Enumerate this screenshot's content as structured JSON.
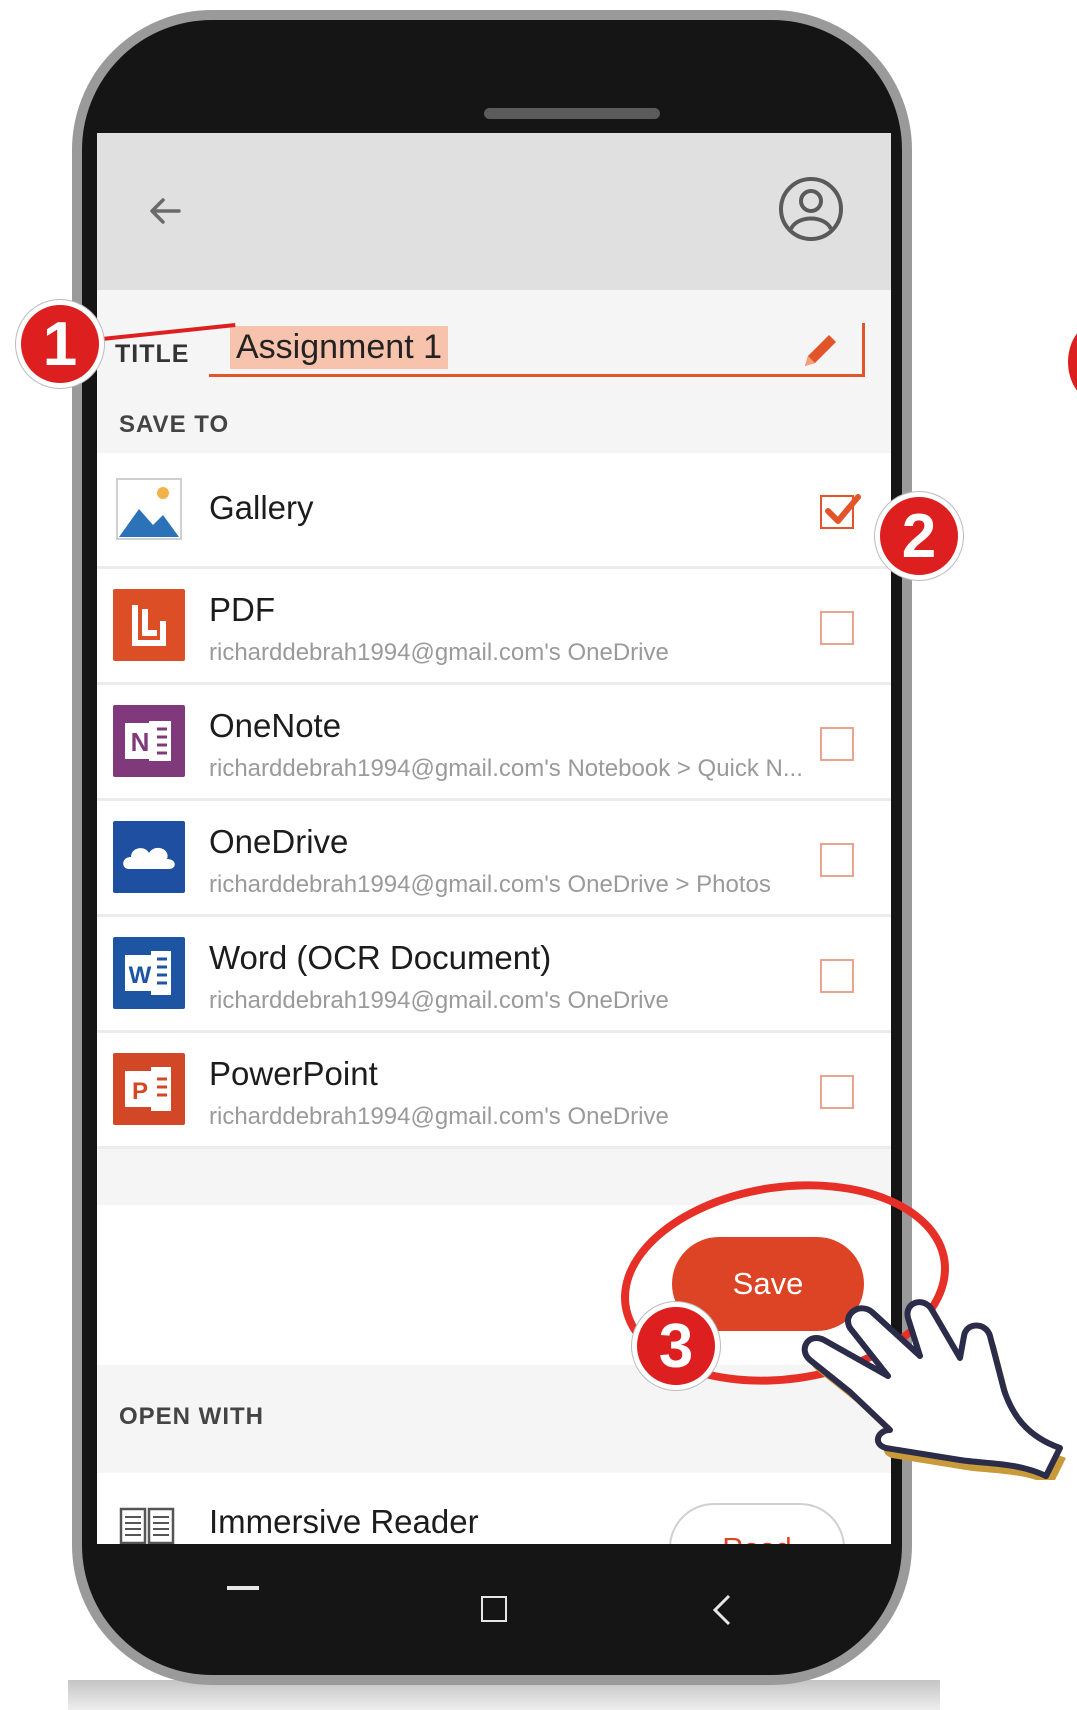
{
  "header": {
    "back_icon": "arrow-left-icon",
    "account_icon": "account-circle-icon"
  },
  "title": {
    "label": "TITLE",
    "value": "Assignment 1",
    "edit_icon": "pencil-icon"
  },
  "save_to": {
    "label": "SAVE TO",
    "items": [
      {
        "name": "Gallery",
        "subtitle": "",
        "checked": true,
        "icon": "gallery-icon"
      },
      {
        "name": "PDF",
        "subtitle": "richarddebrah1994@gmail.com's OneDrive",
        "checked": false,
        "icon": "pdf-icon"
      },
      {
        "name": "OneNote",
        "subtitle": "richarddebrah1994@gmail.com's Notebook > Quick N...",
        "checked": false,
        "icon": "onenote-icon"
      },
      {
        "name": "OneDrive",
        "subtitle": "richarddebrah1994@gmail.com's OneDrive > Photos",
        "checked": false,
        "icon": "onedrive-icon"
      },
      {
        "name": "Word (OCR Document)",
        "subtitle": "richarddebrah1994@gmail.com's OneDrive",
        "checked": false,
        "icon": "word-icon"
      },
      {
        "name": "PowerPoint",
        "subtitle": "richarddebrah1994@gmail.com's OneDrive",
        "checked": false,
        "icon": "powerpoint-icon"
      }
    ]
  },
  "save_button": "Save",
  "open_with": {
    "label": "OPEN WITH",
    "items": [
      {
        "name": "Immersive Reader",
        "action": "Read",
        "icon": "book-icon"
      }
    ]
  },
  "annotations": {
    "step1": "1",
    "step2": "2",
    "step3": "3"
  },
  "colors": {
    "accent": "#dd4425",
    "badge": "#dd1f1f",
    "appbar": "#e0e0e0"
  }
}
